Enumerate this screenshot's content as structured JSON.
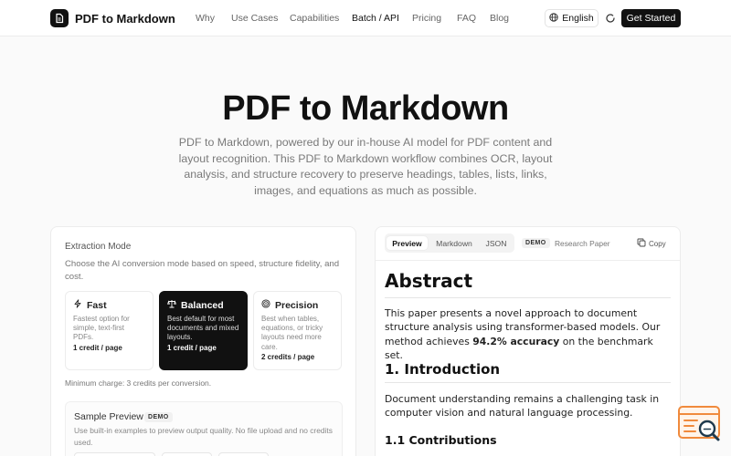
{
  "header": {
    "brand": "PDF to Markdown",
    "nav": [
      "Why",
      "Use Cases",
      "Capabilities",
      "Batch / API",
      "Pricing",
      "FAQ",
      "Blog"
    ],
    "active_nav": "Batch / API",
    "language": "English",
    "cta": "Get Started"
  },
  "hero": {
    "title": "PDF to Markdown",
    "description": "PDF to Markdown, powered by our in-house AI model for PDF content and layout recognition. This PDF to Markdown workflow combines OCR, layout analysis, and structure recovery to preserve headings, tables, lists, links, images, and equations as much as possible."
  },
  "extraction": {
    "title": "Extraction Mode",
    "description": "Choose the AI conversion mode based on speed, structure fidelity, and cost.",
    "modes": [
      {
        "name": "Fast",
        "desc": "Fastest option for simple, text-first PDFs.",
        "credits": "1 credit / page",
        "icon": "lightning-icon",
        "selected": false
      },
      {
        "name": "Balanced",
        "desc": "Best default for most documents and mixed layouts.",
        "credits": "1 credit / page",
        "icon": "scale-icon",
        "selected": true
      },
      {
        "name": "Precision",
        "desc": "Best when tables, equations, or tricky layouts need more care.",
        "credits": "2 credits / page",
        "icon": "target-icon",
        "selected": false
      }
    ],
    "min_charge": "Minimum charge: 3 credits per conversion."
  },
  "sample": {
    "title": "Sample Preview",
    "badge": "DEMO",
    "description": "Use built-in examples to preview output quality. No file upload and no credits used."
  },
  "preview": {
    "tabs": [
      "Preview",
      "Markdown",
      "JSON"
    ],
    "active_tab": "Preview",
    "badge": "DEMO",
    "sample_name": "Research Paper",
    "copy_label": "Copy",
    "content": {
      "h1": "Abstract",
      "p1_before": "This paper presents a novel approach to document structure analysis using transformer-based models. Our method achieves ",
      "p1_bold": "94.2% accuracy",
      "p1_after": " on the benchmark set.",
      "h2": "1. Introduction",
      "p2": "Document understanding remains a challenging task in computer vision and natural language processing.",
      "h3": "1.1 Contributions"
    }
  },
  "colors": {
    "primary": "#111111",
    "muted_text": "#7a7a7a",
    "border": "#ececec",
    "widget_accent": "#f08a3c"
  }
}
